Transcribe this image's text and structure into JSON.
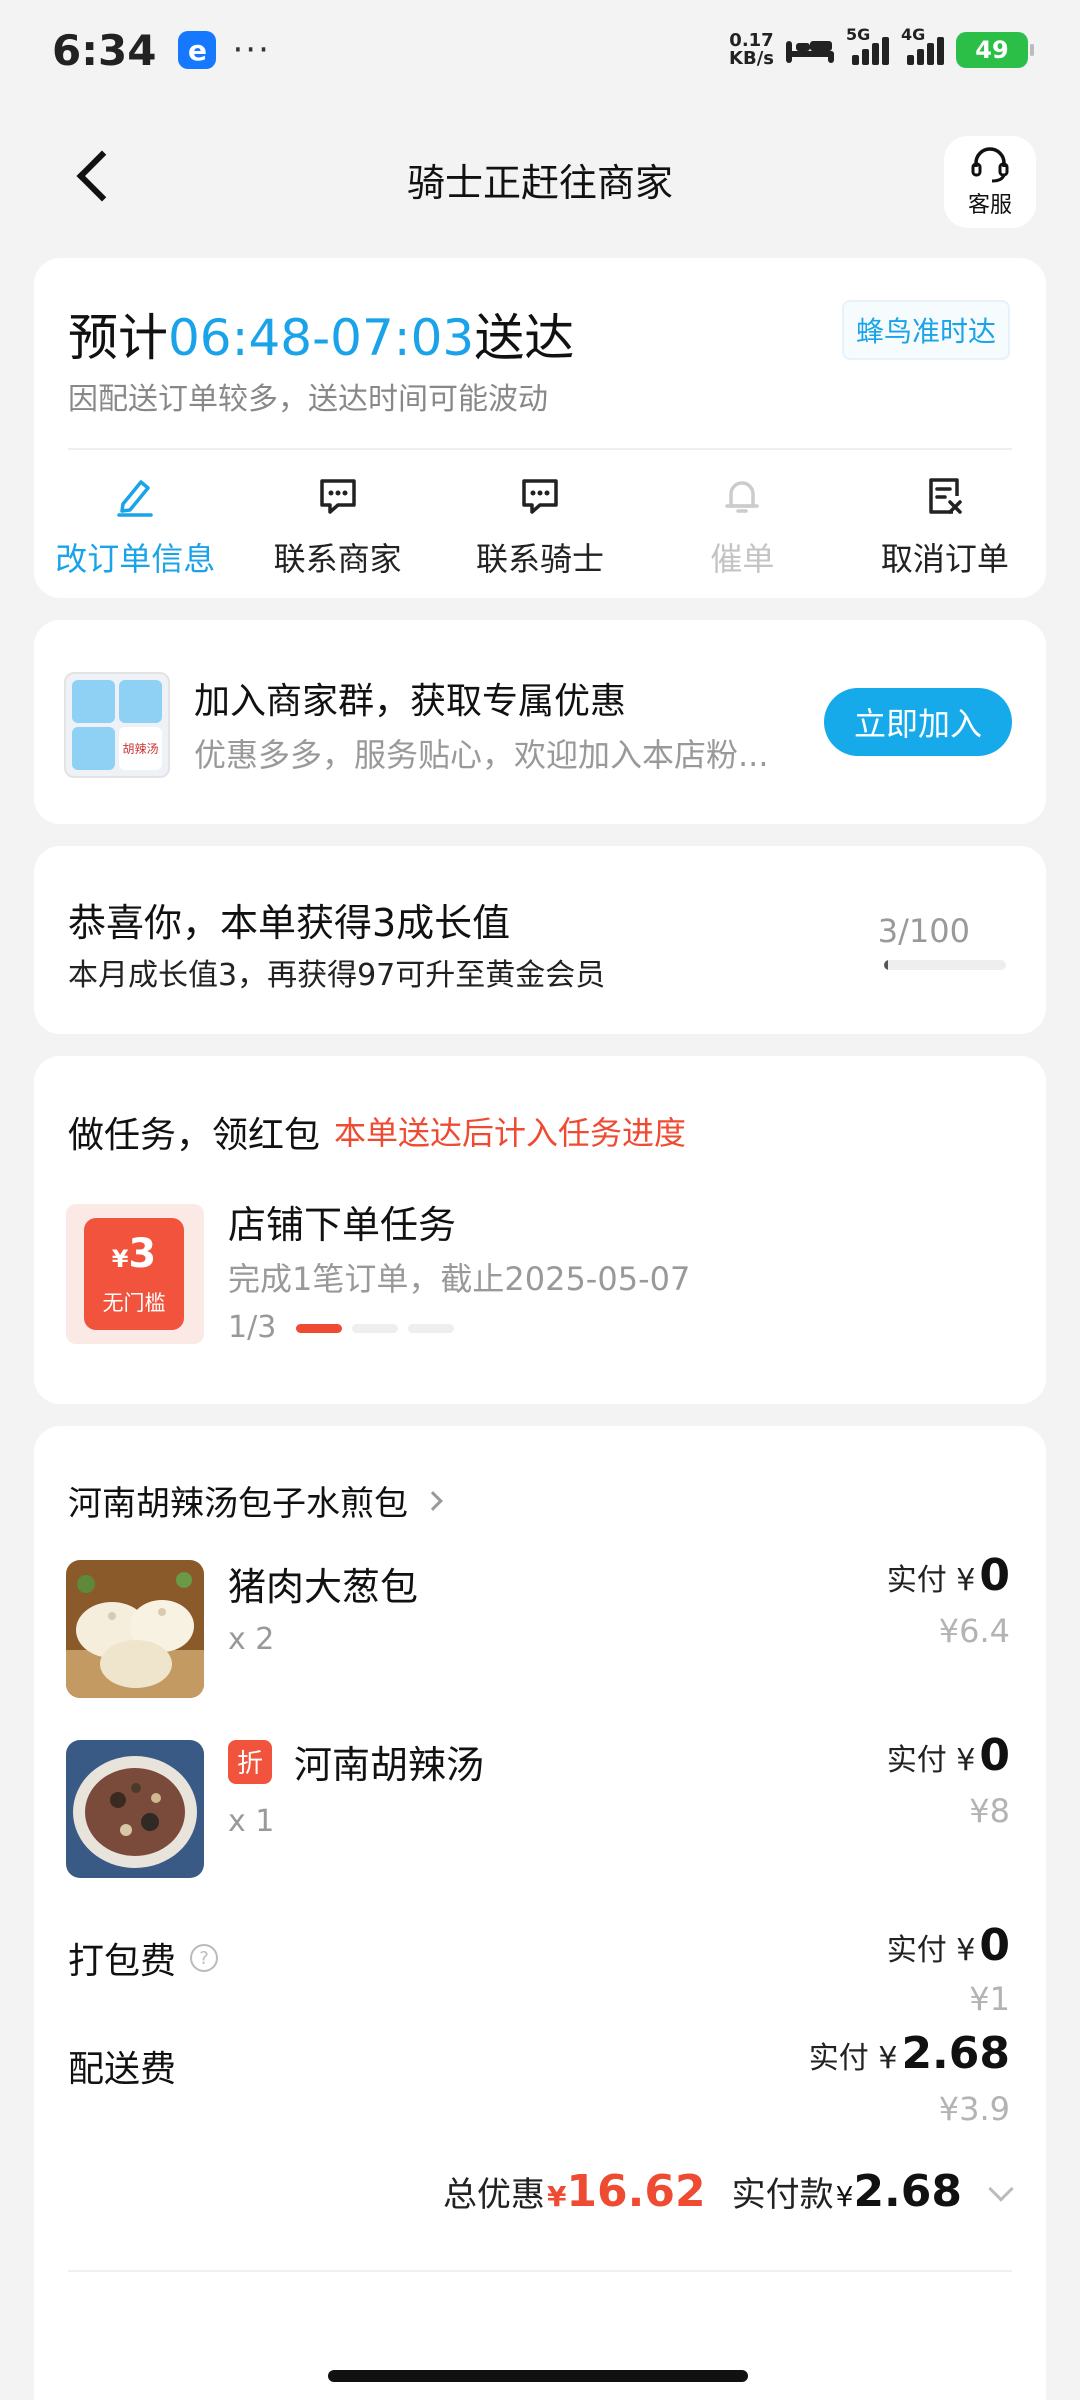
{
  "status_bar": {
    "time": "6:34",
    "app_icon_letter": "e",
    "more": "···",
    "net_speed_value": "0.17",
    "net_speed_unit": "KB/s",
    "signal1_label": "5G",
    "signal2_label": "4G",
    "battery": "49"
  },
  "nav": {
    "title": "骑士正赶往商家",
    "service_label": "客服"
  },
  "delivery": {
    "eta_prefix": "预计",
    "eta_time": "06:48-07:03",
    "eta_suffix": "送达",
    "badge": "蜂鸟准时达",
    "note": "因配送订单较多，送达时间可能波动",
    "actions": [
      {
        "label": "改订单信息",
        "icon": "edit-icon",
        "state": "active"
      },
      {
        "label": "联系商家",
        "icon": "chat-icon",
        "state": "normal"
      },
      {
        "label": "联系骑士",
        "icon": "chat-icon",
        "state": "normal"
      },
      {
        "label": "催单",
        "icon": "bell-icon",
        "state": "disabled"
      },
      {
        "label": "取消订单",
        "icon": "cancel-order-icon",
        "state": "normal"
      }
    ]
  },
  "group": {
    "title": "加入商家群，获取专属优惠",
    "subtitle": "优惠多多，服务贴心，欢迎加入本店粉...",
    "button": "立即加入",
    "logo_text": "胡辣汤"
  },
  "growth": {
    "title": "恭喜你，本单获得3成长值",
    "subtitle": "本月成长值3，再获得97可升至黄金会员",
    "count": "3/100",
    "progress": 0.03
  },
  "task": {
    "title": "做任务，领红包",
    "note": "本单送达后计入任务进度",
    "coupon_symbol": "¥",
    "coupon_amount": "3",
    "coupon_caption": "无门槛",
    "name": "店铺下单任务",
    "desc": "完成1笔订单，截止2025-05-07",
    "progress": "1/3",
    "progress_done": 1,
    "progress_total": 3
  },
  "order": {
    "shop": "河南胡辣汤包子水煎包",
    "paid_label": "实付",
    "currency": "¥",
    "items": [
      {
        "name": "猪肉大葱包",
        "qty": "x 2",
        "paid": "0",
        "original": "¥6.4",
        "tag": ""
      },
      {
        "name": "河南胡辣汤",
        "qty": "x 1",
        "paid": "0",
        "original": "¥8",
        "tag": "折"
      }
    ],
    "packing": {
      "label": "打包费",
      "help": "?",
      "paid": "0",
      "original": "¥1"
    },
    "delivery_fee": {
      "label": "配送费",
      "paid": "2.68",
      "original": "¥3.9"
    },
    "total_discount_label": "总优惠",
    "total_discount": "16.62",
    "total_paid_label": "实付款",
    "total_paid": "2.68"
  },
  "colors": {
    "accent_blue": "#1aa3e8",
    "accent_red": "#ee4b32",
    "battery_green": "#2bbf47"
  }
}
